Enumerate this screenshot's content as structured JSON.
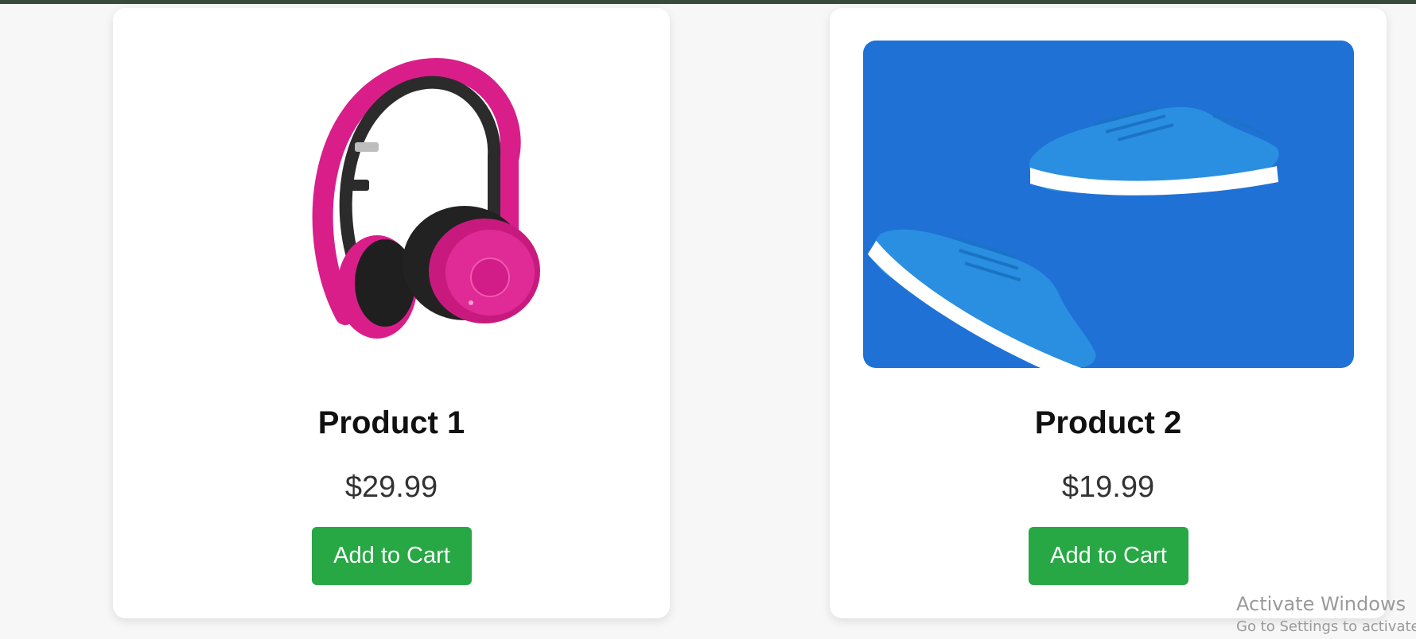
{
  "products": [
    {
      "name": "Product 1",
      "price": "$29.99",
      "button_label": "Add to Cart",
      "image": "pink-headphones",
      "image_alt": "Pink headphones"
    },
    {
      "name": "Product 2",
      "price": "$19.99",
      "button_label": "Add to Cart",
      "image": "blue-sneakers",
      "image_alt": "Blue sneakers"
    }
  ],
  "watermark": {
    "title": "Activate Windows",
    "subtitle": "Go to Settings to activate Wi"
  },
  "colors": {
    "button": "#28a745",
    "sneaker_background": "#1f71d6",
    "headphone_pink": "#d91e8a",
    "top_bar": "#3a4a3a"
  }
}
